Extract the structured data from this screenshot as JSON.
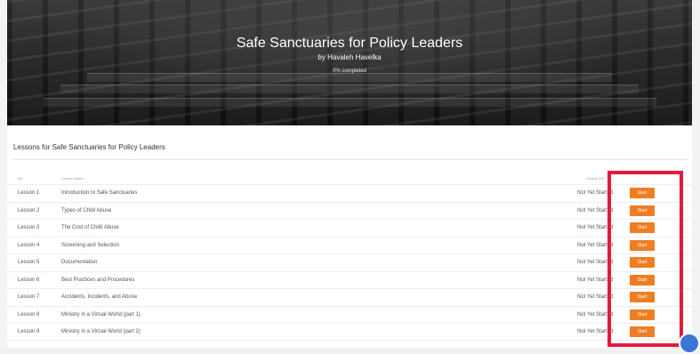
{
  "course": {
    "title": "Safe Sanctuaries for Policy Leaders",
    "author": "by Havaleh Havelka",
    "progress_text": "0% completed"
  },
  "lessons_section": {
    "title": "Lessons for Safe Sanctuaries for Policy Leaders",
    "headers": {
      "number": "No.",
      "name": "Lesson Name",
      "progress": "Lesson Pro"
    },
    "rows": [
      {
        "number": "Lesson 1",
        "name": "Introduction to Safe Sanctuaries",
        "status": "Not Yet Started",
        "action": "Start"
      },
      {
        "number": "Lesson 2",
        "name": "Types of Child Abuse",
        "status": "Not Yet Started",
        "action": "Start"
      },
      {
        "number": "Lesson 3",
        "name": "The Cost of Child Abuse",
        "status": "Not Yet Started",
        "action": "Start"
      },
      {
        "number": "Lesson 4",
        "name": "Screening and Selection",
        "status": "Not Yet Started",
        "action": "Start"
      },
      {
        "number": "Lesson 5",
        "name": "Documentation",
        "status": "Not Yet Started",
        "action": "Start"
      },
      {
        "number": "Lesson 6",
        "name": "Best Practices and Procedures",
        "status": "Not Yet Started",
        "action": "Start"
      },
      {
        "number": "Lesson 7",
        "name": "Accidents, Incidents, and Abuse",
        "status": "Not Yet Started",
        "action": "Start"
      },
      {
        "number": "Lesson 8",
        "name": "Ministry in a Virtual World (part 1)",
        "status": "Not Yet Started",
        "action": "Start"
      },
      {
        "number": "Lesson 9",
        "name": "Ministry in a Virtual World (part 2)",
        "status": "Not Yet Started",
        "action": "Start"
      }
    ]
  },
  "colors": {
    "accent_orange": "#ef7d22",
    "highlight_red": "#e21a3b",
    "chat_blue": "#3a76d8"
  }
}
